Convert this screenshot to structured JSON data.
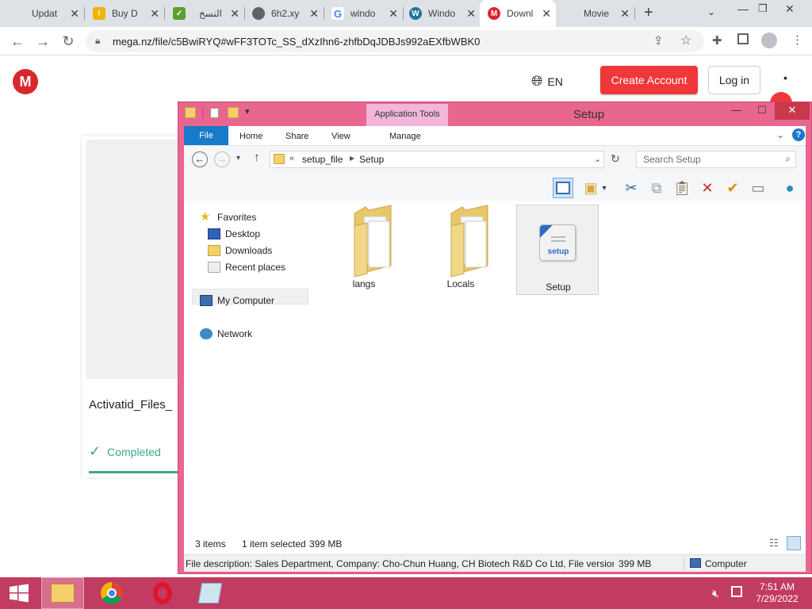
{
  "browser": {
    "tabs": [
      {
        "title": "Updat",
        "icon": "update-icon",
        "color": "#fff"
      },
      {
        "title": "Buy D",
        "icon": "lock-key-icon",
        "color": "#f0b400"
      },
      {
        "title": "النسخ",
        "icon": "checkmark-icon",
        "color": "#5aa02c"
      },
      {
        "title": "6h2.xy",
        "icon": "globe-icon",
        "color": "#5f6368"
      },
      {
        "title": "windo",
        "icon": "google-icon",
        "color": "#4285f4"
      },
      {
        "title": "Windo",
        "icon": "wordpress-icon",
        "color": "#21759b"
      },
      {
        "title": "Downl",
        "icon": "mega-icon",
        "color": "#d9272e"
      },
      {
        "title": "Movie",
        "icon": "movie-icon",
        "color": "#fff"
      }
    ],
    "url": "mega.nz/file/c5BwiRYQ#wFF3TOTc_SS_dXzIhn6-zhfbDqJDBJs992aEXfbWBK0"
  },
  "mega": {
    "logo": "M",
    "lang": "EN",
    "create_account": "Create Account",
    "login": "Log in",
    "file_name": "Activatid_Files_",
    "status": "Completed",
    "accent": "#f0373a",
    "success": "#3da78e"
  },
  "explorer": {
    "title": "Setup",
    "app_tools": "Application Tools",
    "ribbon": {
      "file": "File",
      "home": "Home",
      "share": "Share",
      "view": "View",
      "manage": "Manage"
    },
    "path": [
      "setup_file",
      "Setup"
    ],
    "path_prefix": "«",
    "search_placeholder": "Search Setup",
    "nav": {
      "favorites": "Favorites",
      "desktop": "Desktop",
      "downloads": "Downloads",
      "recent": "Recent places",
      "computer": "My Computer",
      "network": "Network"
    },
    "items": [
      {
        "name": "langs",
        "type": "folder"
      },
      {
        "name": "Locals",
        "type": "folder"
      },
      {
        "name": "Setup",
        "type": "setup",
        "icon_text": "setup"
      }
    ],
    "status": {
      "count": "3 items",
      "selected": "1 item selected",
      "size": "399 MB"
    },
    "desc": {
      "text": "File description: Sales Department, Company: Cho-Chun Huang, CH Biotech R&D Co Ltd, File version: (",
      "size": "399 MB",
      "location": "Computer"
    },
    "frame_color": "#e9668f"
  },
  "taskbar": {
    "time": "7:51 AM",
    "date": "7/29/2022",
    "color": "#c23b60"
  }
}
